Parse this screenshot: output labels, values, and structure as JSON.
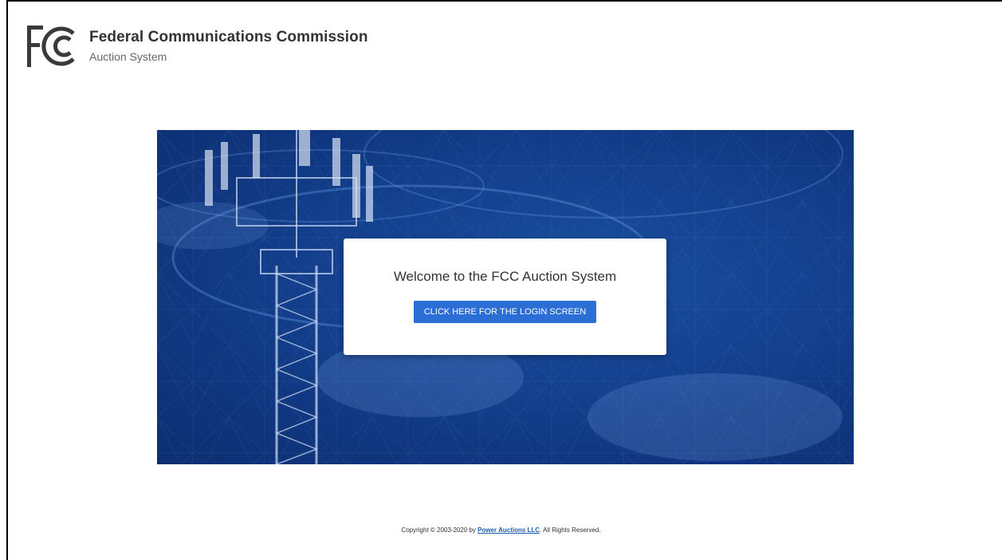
{
  "header": {
    "title": "Federal Communications Commission",
    "subtitle": "Auction System"
  },
  "welcome": {
    "message": "Welcome to the FCC Auction System",
    "login_button": "CLICK HERE FOR THE LOGIN SCREEN"
  },
  "footer": {
    "copyright_prefix": "Copyright © 2003-2020 by",
    "company_link": "Power Auctions LLC",
    "suffix": ". All Rights Reserved."
  },
  "colors": {
    "hero_blue": "#14418f",
    "button_blue": "#2b6fd6"
  },
  "icons": {
    "logo": "fcc-logo"
  }
}
